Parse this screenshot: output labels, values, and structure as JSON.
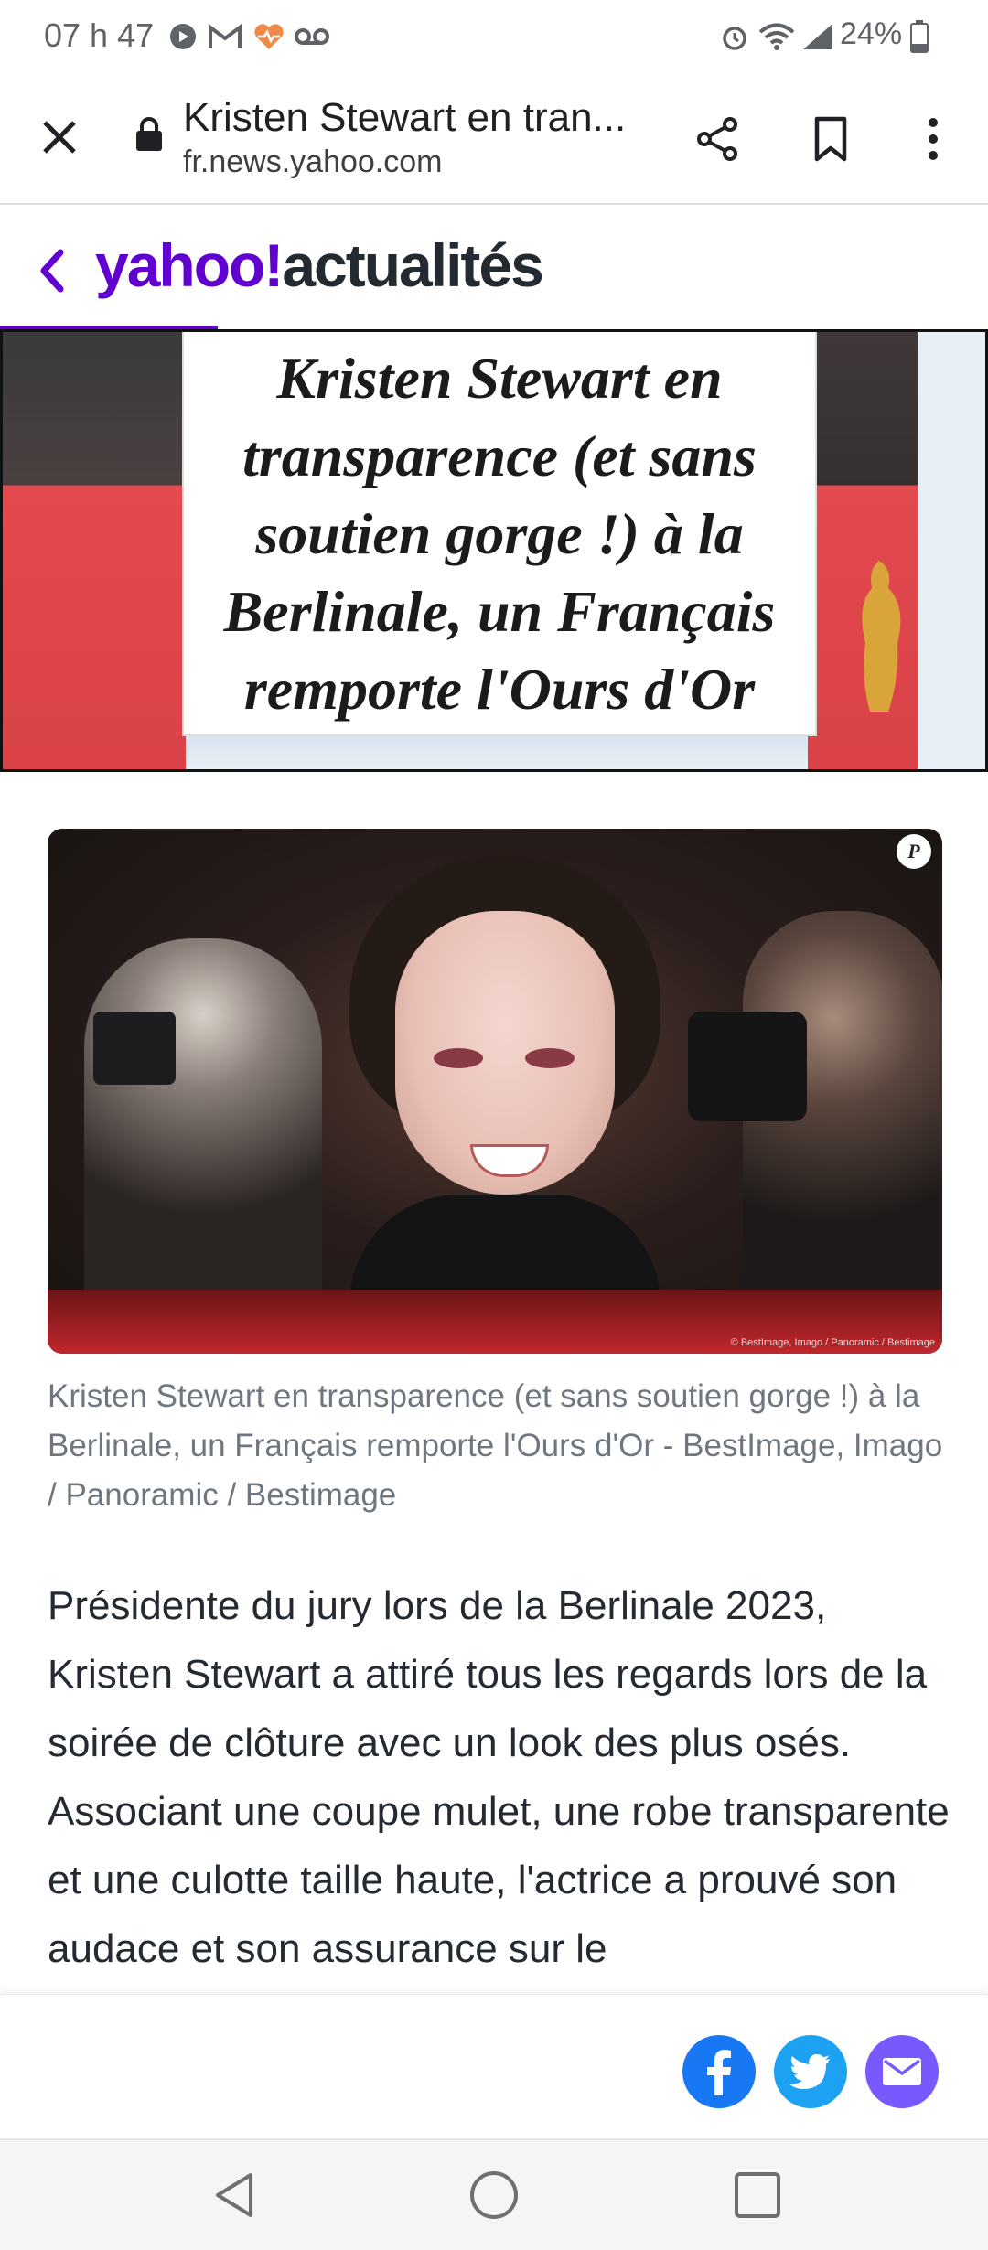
{
  "status_bar": {
    "time": "07 h 47",
    "battery": "24%",
    "left_icons": [
      "playback-icon",
      "gmail-icon",
      "health-heart-icon",
      "voicemail-icon"
    ],
    "right_icons": [
      "alarm-icon",
      "wifi-icon",
      "signal-icon",
      "battery-icon"
    ]
  },
  "browser": {
    "title": "Kristen Stewart en tran...",
    "url": "fr.news.yahoo.com",
    "icons": [
      "close-icon",
      "lock-icon",
      "share-icon",
      "bookmark-icon",
      "more-vert-icon"
    ]
  },
  "site_header": {
    "logo_yahoo": "yahoo!",
    "logo_section": "actualités",
    "accent_color": "#6001d2",
    "back_icon": "chevron-left-icon"
  },
  "hero": {
    "headline": "Kristen Stewart en transparence (et sans soutien gorge !) à la Berlinale, un Français remporte l'Ours d'Or"
  },
  "article_image": {
    "badge": "P",
    "credit": "© BestImage, Imago / Panoramic / Bestimage"
  },
  "caption": "Kristen Stewart en transparence (et sans soutien gorge !) à la Berlinale, un Français remporte l'Ours d'Or - BestImage, Imago / Panoramic / Bestimage",
  "body": "Présidente du jury lors de la Berlinale 2023, Kristen Stewart a attiré tous les regards lors de la soirée de clôture avec un look des plus osés. Associant une coupe mulet, une robe transparente et une culotte taille haute, l'actrice a prouvé son audace et son assurance sur le",
  "share": {
    "facebook_color": "#1877f2",
    "twitter_color": "#1da1f2",
    "email_color": "#7759ff"
  },
  "nav": [
    "back-triangle-icon",
    "home-circle-icon",
    "recents-square-icon"
  ]
}
